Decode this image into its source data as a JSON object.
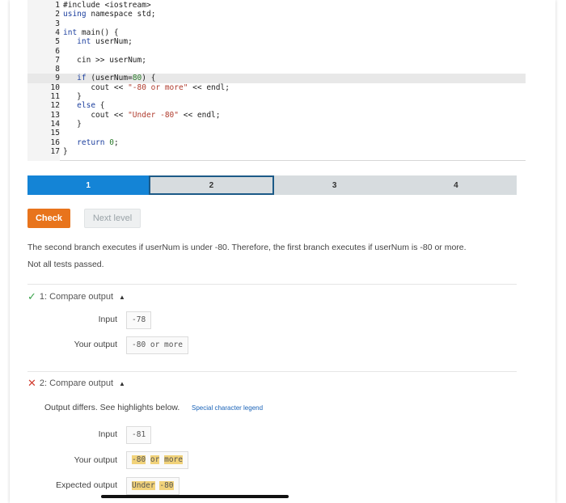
{
  "code_lines": [
    {
      "n": "1",
      "parts": [
        {
          "t": "#include <iostream>",
          "c": ""
        }
      ]
    },
    {
      "n": "2",
      "parts": [
        {
          "t": "using ",
          "c": "kw"
        },
        {
          "t": "namespace",
          "c": ""
        },
        {
          "t": " std;",
          "c": ""
        }
      ]
    },
    {
      "n": "3",
      "parts": []
    },
    {
      "n": "4",
      "parts": [
        {
          "t": "int",
          "c": "kw"
        },
        {
          "t": " main() {",
          "c": ""
        }
      ]
    },
    {
      "n": "5",
      "parts": [
        {
          "t": "   int",
          "c": "kw"
        },
        {
          "t": " userNum;",
          "c": ""
        }
      ]
    },
    {
      "n": "6",
      "parts": []
    },
    {
      "n": "7",
      "parts": [
        {
          "t": "   cin >> userNum;",
          "c": ""
        }
      ]
    },
    {
      "n": "8",
      "parts": []
    },
    {
      "n": "9",
      "parts": [
        {
          "t": "   if",
          "c": "kw"
        },
        {
          "t": " (userNum=",
          "c": ""
        },
        {
          "t": "80",
          "c": "num"
        },
        {
          "t": ") {",
          "c": ""
        }
      ]
    },
    {
      "n": "10",
      "parts": [
        {
          "t": "      cout << ",
          "c": ""
        },
        {
          "t": "\"-80 or more\"",
          "c": "str"
        },
        {
          "t": " << endl;",
          "c": ""
        }
      ]
    },
    {
      "n": "11",
      "parts": [
        {
          "t": "   }",
          "c": ""
        }
      ]
    },
    {
      "n": "12",
      "parts": [
        {
          "t": "   else",
          "c": "kw"
        },
        {
          "t": " {",
          "c": ""
        }
      ]
    },
    {
      "n": "13",
      "parts": [
        {
          "t": "      cout << ",
          "c": ""
        },
        {
          "t": "\"Under -80\"",
          "c": "str"
        },
        {
          "t": " << endl;",
          "c": ""
        }
      ]
    },
    {
      "n": "14",
      "parts": [
        {
          "t": "   }",
          "c": ""
        }
      ]
    },
    {
      "n": "15",
      "parts": []
    },
    {
      "n": "16",
      "parts": [
        {
          "t": "   return",
          "c": "kw"
        },
        {
          "t": " ",
          "c": ""
        },
        {
          "t": "0",
          "c": "num"
        },
        {
          "t": ";",
          "c": ""
        }
      ]
    },
    {
      "n": "17",
      "parts": [
        {
          "t": "}",
          "c": ""
        }
      ]
    }
  ],
  "highlighted_line": "9",
  "progress": {
    "levels": [
      "1",
      "2",
      "3",
      "4"
    ],
    "completed_level": "1",
    "current_level": "2"
  },
  "buttons": {
    "check_label": "Check",
    "next_label": "Next level"
  },
  "explanation": "The second branch executes if userNum is under -80. Therefore, the first branch executes if userNum is -80 or more.",
  "status": "Not all tests passed.",
  "test1": {
    "header": "1: Compare output",
    "input_label": "Input",
    "input_value": "-78",
    "output_label": "Your output",
    "output_value": "-80 or more"
  },
  "test2": {
    "header": "2: Compare output",
    "differs_text": "Output differs. See highlights below.",
    "legend_link": "Special character legend",
    "input_label": "Input",
    "input_value": "-81",
    "output_label": "Your output",
    "output_value": "-80 or more",
    "expected_label": "Expected output",
    "expected_value": "Under -80"
  },
  "colors": {
    "accent_check": "#e8741c",
    "progress_done": "#1484d6",
    "pass": "#3aa34b",
    "fail": "#d13b2e",
    "diff_highlight": "#f1d27a"
  }
}
